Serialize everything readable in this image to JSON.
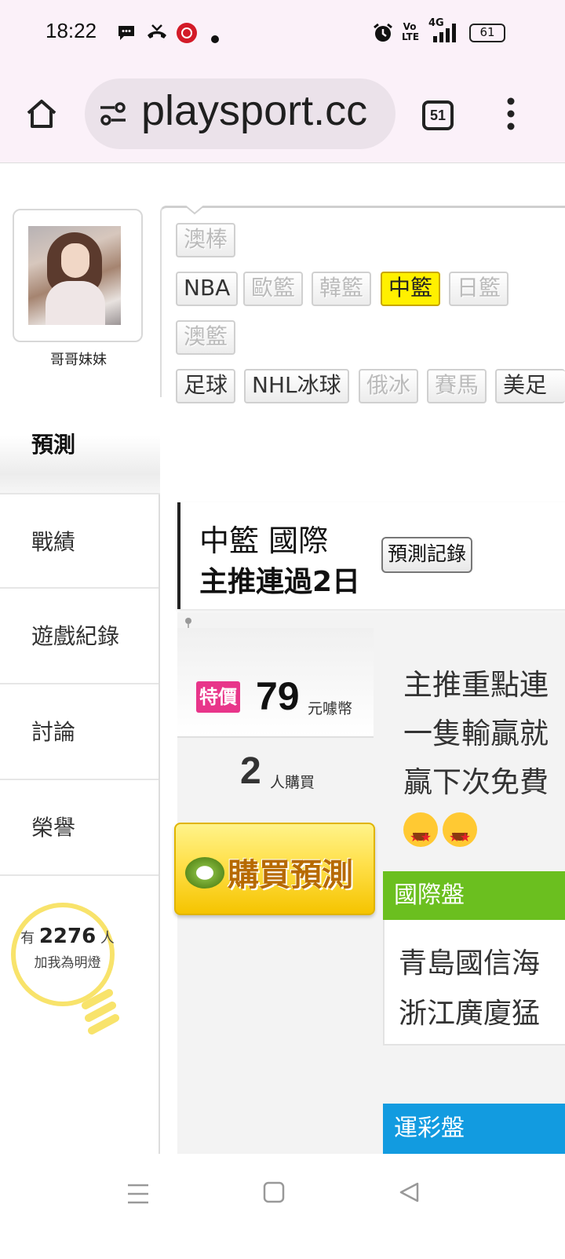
{
  "status_bar": {
    "time": "18:22",
    "battery": "61",
    "network": "4G",
    "volte": "Vo LTE"
  },
  "browser": {
    "url": "playsport.cc",
    "tabs_count": "51"
  },
  "profile": {
    "username": "哥哥妹妹"
  },
  "sidebar": {
    "items": [
      {
        "label": "預測"
      },
      {
        "label": "戰績"
      },
      {
        "label": "遊戲紀錄"
      },
      {
        "label": "討論"
      },
      {
        "label": "榮譽"
      }
    ]
  },
  "fans": {
    "prefix": "有",
    "count": "2276",
    "suffix": "人",
    "caption": "加我為明燈"
  },
  "league_tags": {
    "row1": [
      "澳棒"
    ],
    "row2": [
      "NBA",
      "歐籃",
      "韓籃",
      "中籃",
      "日籃"
    ],
    "row3": [
      "澳籃"
    ],
    "row4": [
      "足球",
      "NHL冰球",
      "俄冰",
      "賽馬",
      "美足"
    ],
    "selected": "中籃"
  },
  "prediction": {
    "title": "中籃 國際",
    "subtitle": "主推連過2日",
    "record_button": "預測記錄",
    "price_tag": "特價",
    "price": "79",
    "price_unit": "元噱幣",
    "buyers": "2",
    "buyers_label": "人購買",
    "buy_button": "購買預測",
    "description_lines": [
      "主推重點連",
      "一隻輸贏就",
      "贏下次免費"
    ],
    "intl_header": "國際盤",
    "teams": [
      "青島國信海",
      "浙江廣廈猛"
    ],
    "sport_header": "運彩盤"
  },
  "colors": {
    "selected_tag": "#fff000",
    "price_tag": "#e8358a",
    "intl_header": "#6bbf1f",
    "sport_header": "#129be0",
    "buy_button": "#ffe04a"
  }
}
